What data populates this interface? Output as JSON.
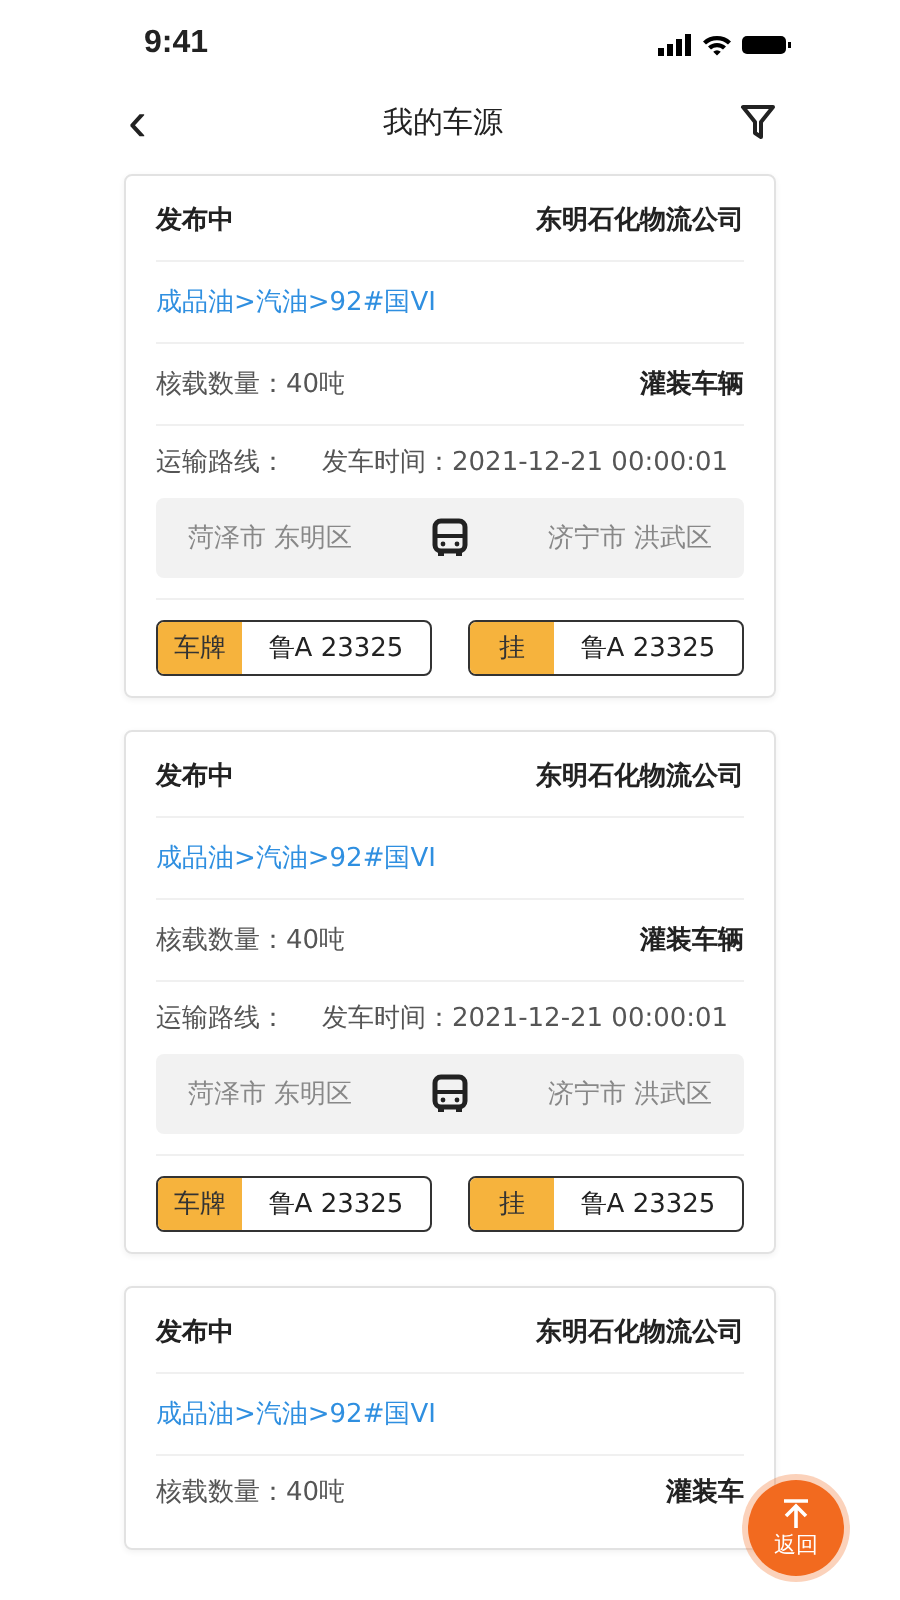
{
  "status_bar": {
    "time": "9:41"
  },
  "nav": {
    "back": "‹",
    "title": "我的车源"
  },
  "cards": [
    {
      "status": "发布中",
      "company": "东明石化物流公司",
      "product": "成品油>汽油>92#国VI",
      "quantity": "核载数量：40吨",
      "vehicle_type": "灌装车辆",
      "route_label": "运输路线：",
      "departure": "发车时间：2021-12-21 00:00:01",
      "origin": "菏泽市 东明区",
      "destination": "济宁市 洪武区",
      "plates": [
        {
          "label": "车牌",
          "number": "鲁A 23325"
        },
        {
          "label": "挂",
          "number": "鲁A 23325"
        }
      ]
    },
    {
      "status": "发布中",
      "company": "东明石化物流公司",
      "product": "成品油>汽油>92#国VI",
      "quantity": "核载数量：40吨",
      "vehicle_type": "灌装车辆",
      "route_label": "运输路线：",
      "departure": "发车时间：2021-12-21 00:00:01",
      "origin": "菏泽市 东明区",
      "destination": "济宁市 洪武区",
      "plates": [
        {
          "label": "车牌",
          "number": "鲁A 23325"
        },
        {
          "label": "挂",
          "number": "鲁A 23325"
        }
      ]
    },
    {
      "status": "发布中",
      "company": "东明石化物流公司",
      "product": "成品油>汽油>92#国VI",
      "quantity": "核载数量：40吨",
      "vehicle_type": "灌装车"
    }
  ],
  "back_to_top": {
    "label": "返回"
  }
}
